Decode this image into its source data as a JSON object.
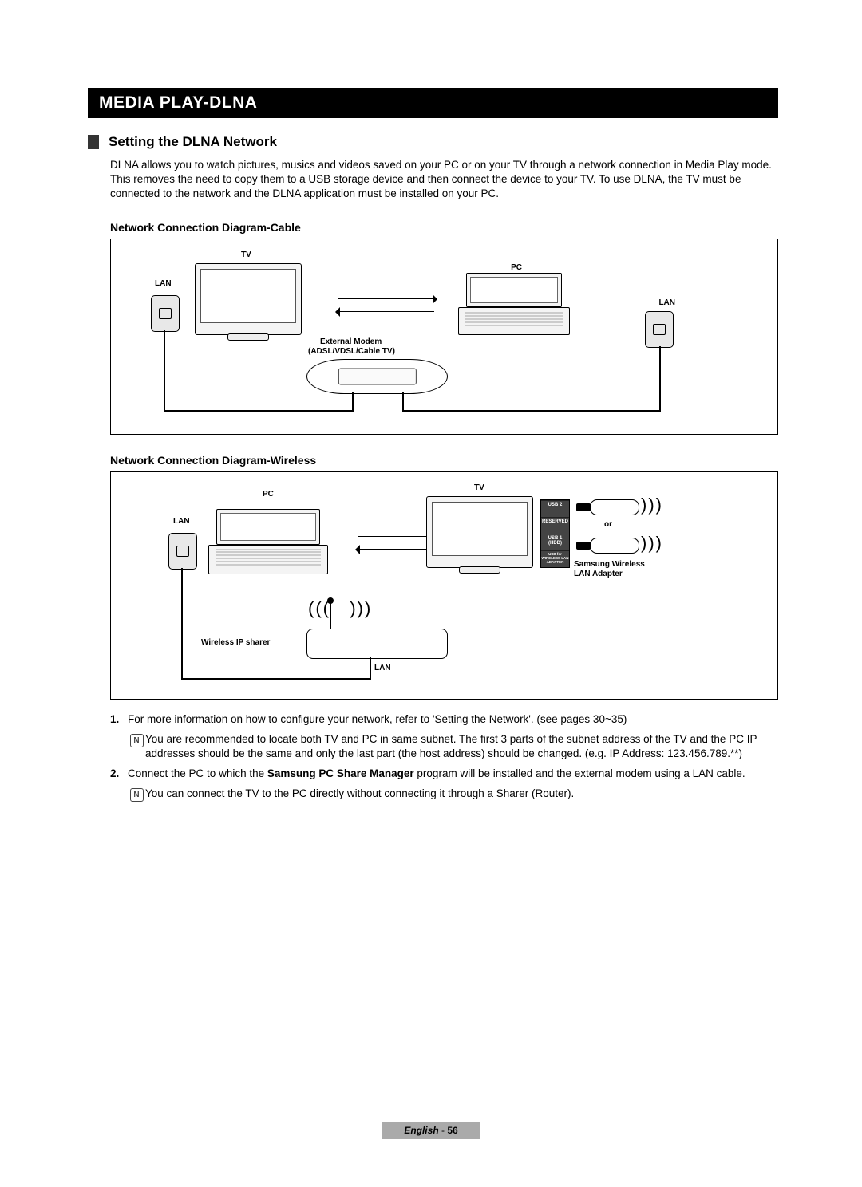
{
  "chapter": "MEDIA PLAY-DLNA",
  "section": "Setting the DLNA Network",
  "intro": "DLNA allows you to watch pictures, musics and videos saved on your PC or on your TV through a network connection in Media Play mode. This removes the need to copy them to a USB storage device and then connect the device to your TV. To use DLNA, the TV must be connected to the network and the DLNA application must be installed on your PC.",
  "diag_cable": {
    "heading": "Network Connection Diagram-Cable",
    "labels": {
      "TV": "TV",
      "PC": "PC",
      "LAN_left": "LAN",
      "LAN_right": "LAN",
      "modem1": "External Modem",
      "modem2": "(ADSL/VDSL/Cable TV)"
    }
  },
  "diag_wireless": {
    "heading": "Network Connection Diagram-Wireless",
    "labels": {
      "TV": "TV",
      "PC": "PC",
      "LAN_top": "LAN",
      "LAN_bot": "LAN",
      "router": "Wireless IP sharer",
      "or": "or",
      "adapter1": "Samsung Wireless",
      "adapter2": "LAN Adapter",
      "port_usb2": "USB 2",
      "port_reserved": "RESERVED",
      "port_usb1": "USB 1 (HDD)",
      "port_wis": "USB for WIRELESS LAN ADAPTER"
    }
  },
  "notes": {
    "n1": "For more information on how to configure your network, refer to 'Setting the Network'. (see pages 30~35)",
    "n1_hint": "You are recommended to locate both TV and PC in same subnet. The first 3 parts of the subnet address of the TV and the PC IP addresses should be the same and only the last part (the host address) should be changed. (e.g. IP Address: 123.456.789.**)",
    "n2_pre": "Connect the PC to which the ",
    "n2_bold": "Samsung PC Share Manager",
    "n2_post": " program will be installed and the external modem using a LAN cable.",
    "n2_hint": "You can connect the TV to the PC directly without connecting it through a Sharer (Router).",
    "num1": "1.",
    "num2": "2."
  },
  "footer": {
    "lang": "English",
    "sep": " - ",
    "page": "56"
  }
}
